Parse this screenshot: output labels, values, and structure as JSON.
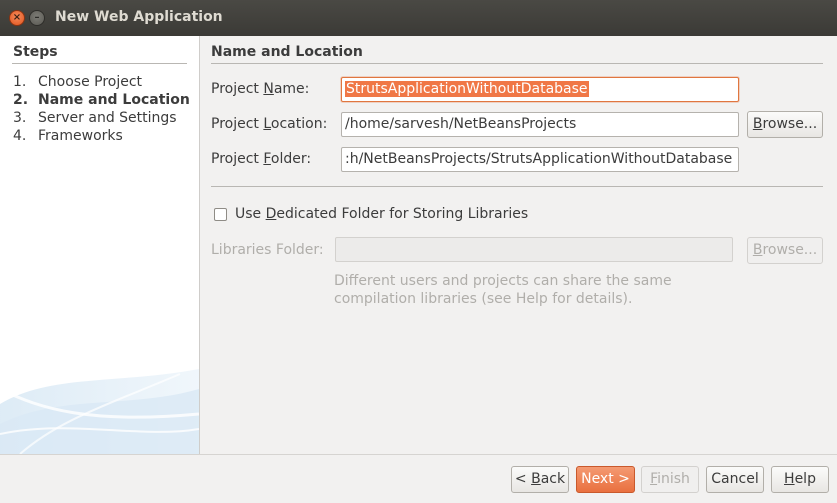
{
  "window": {
    "title": "New Web Application",
    "close_glyph": "×",
    "minimize_glyph": "–"
  },
  "steps": {
    "title": "Steps",
    "items": [
      {
        "num": "1.",
        "label": "Choose Project"
      },
      {
        "num": "2.",
        "label": "Name and Location"
      },
      {
        "num": "3.",
        "label": "Server and Settings"
      },
      {
        "num": "4.",
        "label": "Frameworks"
      }
    ]
  },
  "form": {
    "section_title": "Name and Location",
    "project_name": {
      "label_pre": "Project ",
      "label_mn": "N",
      "label_post": "ame:",
      "value": "StrutsApplicationWithoutDatabase"
    },
    "project_location": {
      "label_pre": "Project ",
      "label_mn": "L",
      "label_post": "ocation:",
      "value": "/home/sarvesh/NetBeansProjects"
    },
    "project_folder": {
      "label_pre": "Project ",
      "label_mn": "F",
      "label_post": "older:",
      "value": ":h/NetBeansProjects/StrutsApplicationWithoutDatabase"
    },
    "browse_label": {
      "mn": "B",
      "rest": "rowse..."
    },
    "dedicated_folder": {
      "pre": "Use ",
      "mn": "D",
      "post": "edicated Folder for Storing Libraries"
    },
    "libraries_folder_label": "Libraries Folder:",
    "libraries_folder_value": "",
    "hint_line1": "Different users and projects can share the same",
    "hint_line2": "compilation libraries (see Help for details)."
  },
  "buttons": {
    "back": {
      "pre": "< ",
      "mn": "B",
      "post": "ack"
    },
    "next": "Next >",
    "finish": {
      "mn": "F",
      "post": "inish"
    },
    "cancel": "Cancel",
    "help": {
      "mn": "H",
      "post": "elp"
    }
  }
}
